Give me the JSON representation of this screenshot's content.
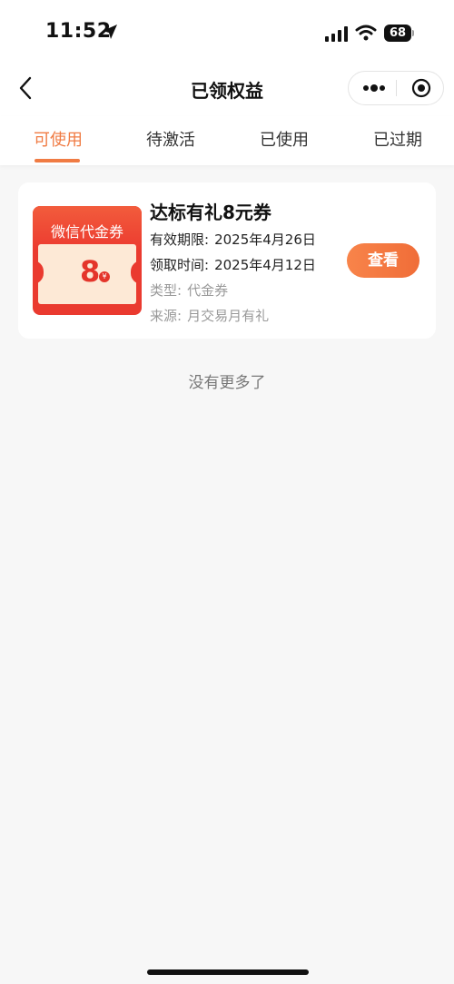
{
  "status": {
    "time": "11:52",
    "battery": "68"
  },
  "nav": {
    "title": "已领权益"
  },
  "tabs": [
    {
      "label": "可使用",
      "active": true
    },
    {
      "label": "待激活",
      "active": false
    },
    {
      "label": "已使用",
      "active": false
    },
    {
      "label": "已过期",
      "active": false
    }
  ],
  "coupon": {
    "image_label": "微信代金券",
    "image_amount": "8",
    "image_currency": "¥",
    "title": "达标有礼8元券",
    "validity_label": "有效期限:",
    "validity_value": "2025年4月26日",
    "received_label": "领取时间:",
    "received_value": "2025年4月12日",
    "type_label": "类型:",
    "type_value": "代金券",
    "source_label": "来源:",
    "source_value": "月交易月有礼",
    "view_button": "查看"
  },
  "footer": {
    "no_more": "没有更多了"
  },
  "colors": {
    "accent": "#f07b43",
    "coupon_red": "#ea3a2f"
  }
}
